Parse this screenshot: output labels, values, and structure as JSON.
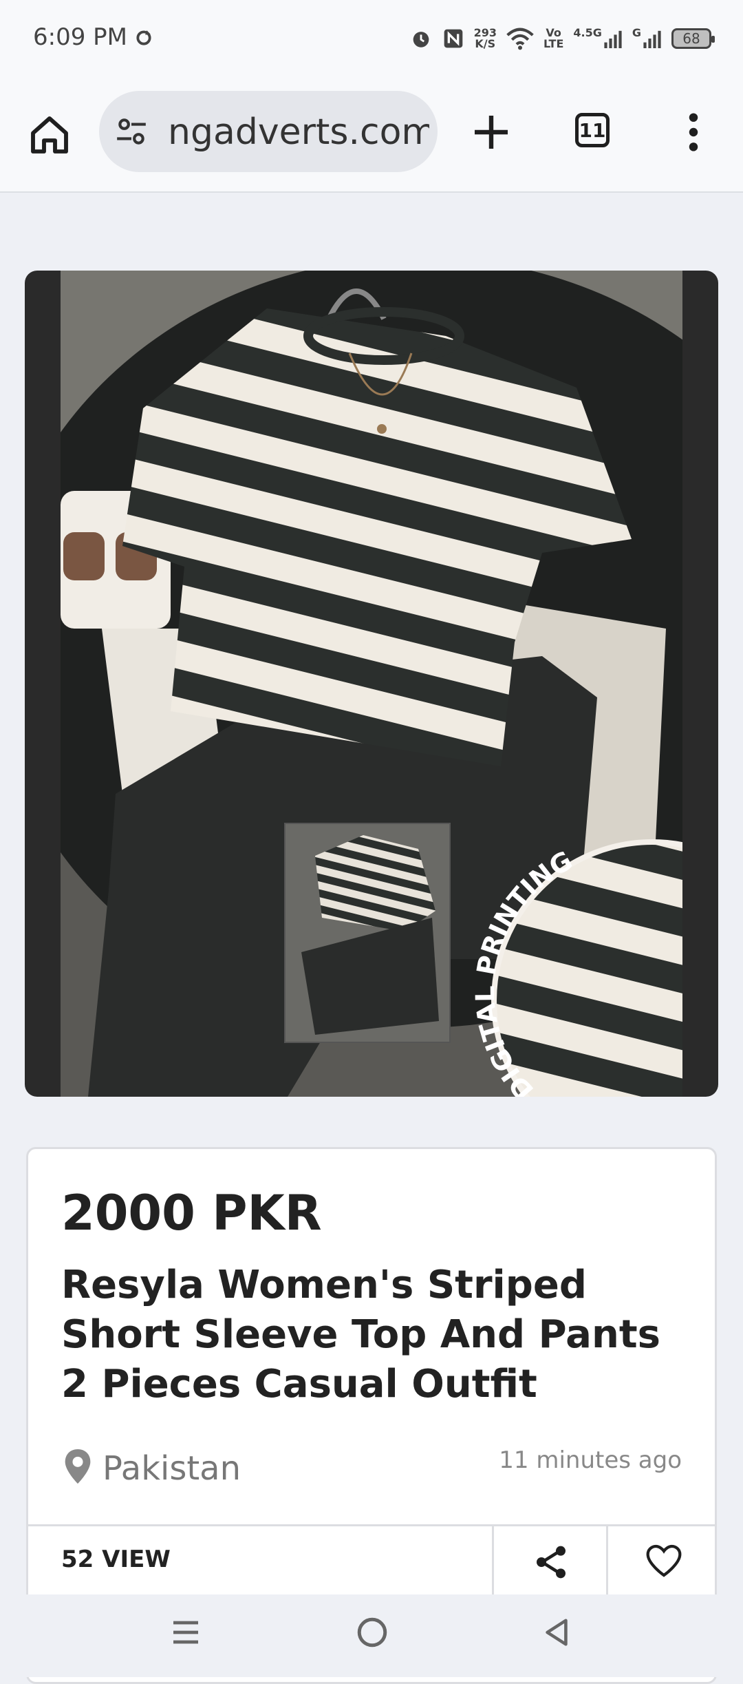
{
  "status_bar": {
    "time": "6:09 PM",
    "net_speed_value": "293",
    "net_speed_unit": "K/S",
    "volte_top": "Vo",
    "volte_bottom": "LTE",
    "network_1": "4.5G",
    "network_2": "G",
    "battery": "68"
  },
  "browser": {
    "url": "ngadverts.com",
    "tab_count": "11"
  },
  "product": {
    "image_overlay_text": "DIGITAL PRINTING",
    "price": "2000 PKR",
    "title": "Resyla Women's Striped Short Sleeve Top And Pants 2 Pieces Casual Outfit",
    "location": "Pakistan",
    "posted": "11 minutes ago",
    "views": "52 VIEW"
  },
  "icons": {
    "home": "home-icon",
    "site_settings": "tune-icon",
    "new_tab": "plus-icon",
    "tabs": "tabs-icon",
    "menu": "more-vert-icon",
    "location": "location-pin-icon",
    "share": "share-icon",
    "favorite": "heart-icon"
  }
}
